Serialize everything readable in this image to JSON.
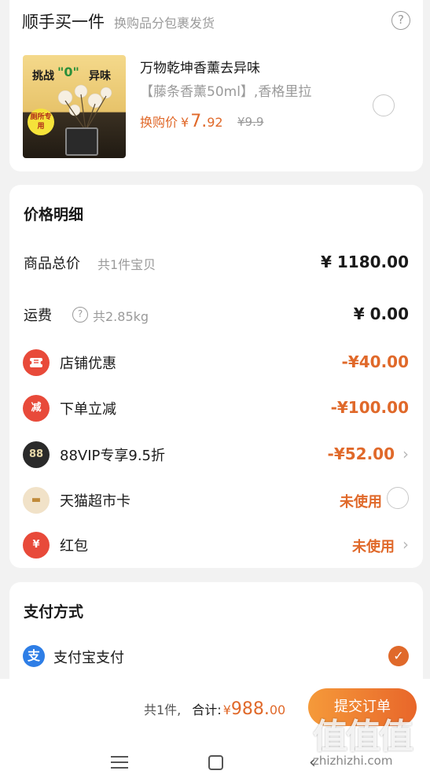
{
  "addon": {
    "title": "顺手买一件",
    "subtitle": "换购品分包裹发货",
    "image_texts": [
      "挑战",
      "\"0\"",
      "异味"
    ],
    "image_badge": "厕所专用",
    "product_name": "万物乾坤香薰去异味",
    "product_spec": "【藤条香薰50ml】,香格里拉",
    "price_label": "换购价",
    "price_currency": "¥",
    "price_int": "7.",
    "price_dec": "92",
    "original_price": "¥9.9"
  },
  "price_detail": {
    "title": "价格明细",
    "rows": [
      {
        "label": "商品总价",
        "sub": "共1件宝贝",
        "value": "¥ 1180.00"
      },
      {
        "label": "运费",
        "sub": "共2.85kg",
        "value": "¥ 0.00"
      },
      {
        "label": "店铺优惠",
        "value": "-¥40.00"
      },
      {
        "label": "下单立减",
        "value": "-¥100.00"
      },
      {
        "label": "88VIP专享9.5折",
        "value": "-¥52.00"
      },
      {
        "label": "天猫超市卡",
        "value": "未使用"
      },
      {
        "label": "红包",
        "value": "未使用"
      }
    ],
    "icons": {
      "coupon": "减",
      "vip": "88",
      "card": "▬",
      "redpack": "¥"
    }
  },
  "payment": {
    "title": "支付方式",
    "method": "支付宝支付",
    "method_icon": "支"
  },
  "bottom": {
    "count": "共1件,",
    "total_label": "合计:",
    "currency": "¥",
    "total_int": "988.",
    "total_dec": "00",
    "submit_label": "提交订单"
  },
  "watermark": {
    "big": "值值值",
    "small": "zhizhizhi.com"
  },
  "colors": {
    "accent": "#e0692a",
    "alipay": "#2e7ee6",
    "muted": "#9a9a9a"
  }
}
